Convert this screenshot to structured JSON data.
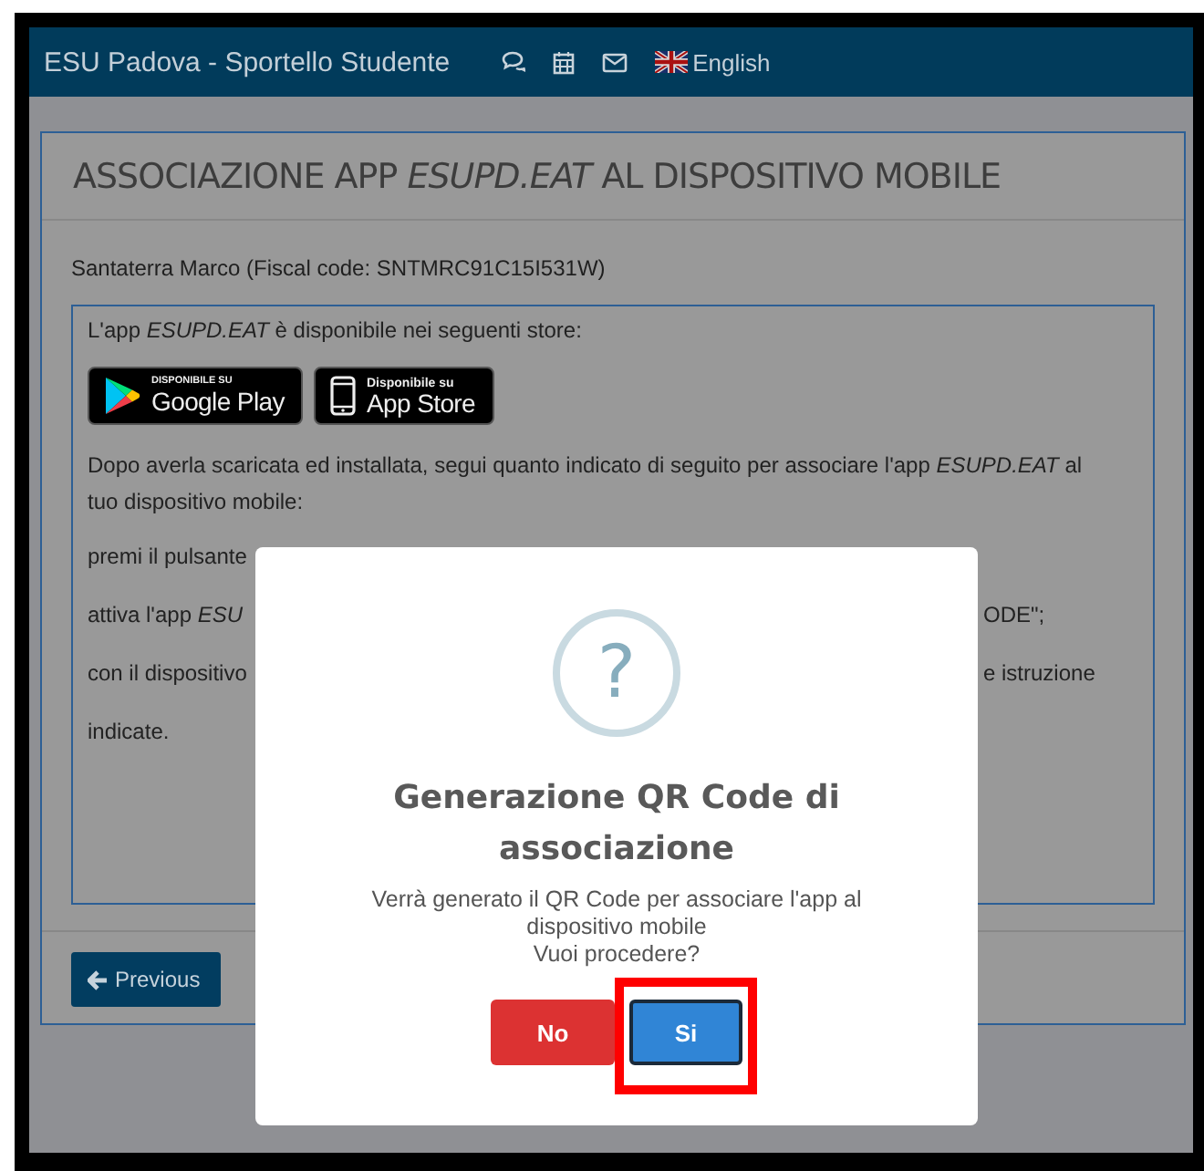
{
  "navbar": {
    "title": "ESU Padova - Sportello Studente",
    "language": "English"
  },
  "panel": {
    "title": "ASSOCIAZIONE APP *ESUPD.EAT* AL DISPOSITIVO MOBILE",
    "student": "Santaterra Marco (Fiscal code: SNTMRC91C15I531W)",
    "availability": "L'app *ESUPD.EAT* è disponibile nei seguenti store:",
    "stores": [
      {
        "kind": "google",
        "caption": "DISPONIBILE SU",
        "name": "Google Play"
      },
      {
        "kind": "apple",
        "caption": "Disponibile su",
        "name": "App Store"
      }
    ],
    "instructions": "Dopo averla scaricata ed installata, segui quanto indicato di seguito per associare l'app *ESUPD.EAT* al tuo dispositivo mobile:",
    "steps": [
      {
        "left": "premi il pulsante"
      },
      {
        "left": "attiva l'app *ESU*",
        "right": "ODE\";"
      },
      {
        "left": "con il dispositivo",
        "right": "e istruzione"
      },
      {
        "left": "indicate."
      }
    ],
    "previous_button": "Previous"
  },
  "dialog": {
    "icon": "?",
    "title": "Generazione QR Code di associazione",
    "message": [
      "Verrà generato il QR Code per associare l'app al dispositivo mobile",
      "Vuoi procedere?"
    ],
    "buttons": [
      {
        "label": "No",
        "kind": "cancel",
        "focused": false,
        "highlighted": false
      },
      {
        "label": "Si",
        "kind": "confirm",
        "focused": true,
        "highlighted": true
      }
    ]
  }
}
